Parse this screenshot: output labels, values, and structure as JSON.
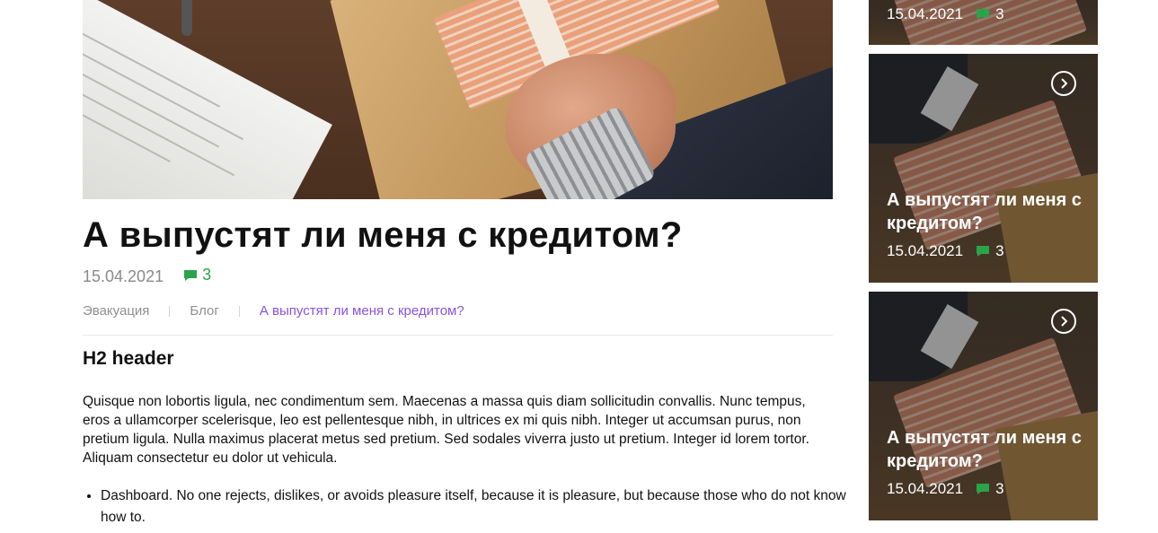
{
  "article": {
    "title": "А выпустят ли меня с кредитом?",
    "date": "15.04.2021",
    "comments": "3",
    "breadcrumb": [
      "Эвакуация",
      "Блог",
      "А выпустят ли меня с кредитом?"
    ],
    "h2": "H2 header",
    "paragraph": "Quisque non lobortis ligula, nec condimentum sem. Maecenas a massa quis diam sollicitudin convallis. Nunc tempus, eros a ullamcorper scelerisque, leo est pellentesque nibh, in ultrices ex mi quis nibh. Integer ut accumsan purus, non pretium ligula. Nulla maximus placerat metus sed pretium. Sed sodales viverra justo ut pretium. Integer id lorem tortor. Aliquam consectetur eu dolor ut vehicula.",
    "list": [
      "Dashboard. No one rejects, dislikes, or avoids pleasure itself, because it is pleasure, but because those who do not know how to."
    ]
  },
  "sidebar": {
    "cards": [
      {
        "title": "",
        "date": "15.04.2021",
        "comments": "3"
      },
      {
        "title": "А выпустят ли меня с кредитом?",
        "date": "15.04.2021",
        "comments": "3"
      },
      {
        "title": "А выпустят ли меня с кредитом?",
        "date": "15.04.2021",
        "comments": "3"
      }
    ]
  },
  "icons": {
    "comment": "chat-bubble-icon",
    "arrow": "chevron-right-icon"
  },
  "colors": {
    "accent_green": "#2aa44a",
    "breadcrumb_current": "#8a52e0",
    "meta_gray": "#8a8a8a"
  }
}
